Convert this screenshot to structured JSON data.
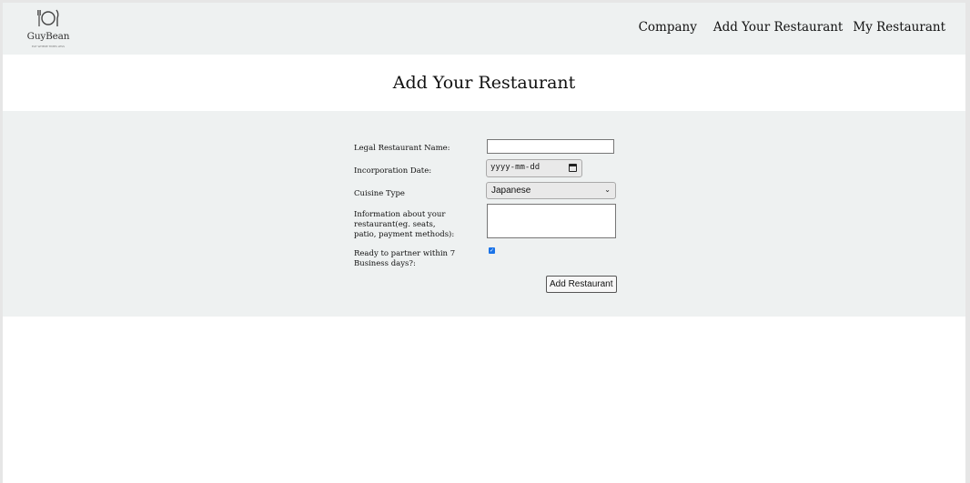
{
  "brand": {
    "name": "GuyBean",
    "tagline": "EAT WHERE TIMES LESS"
  },
  "nav": {
    "items": [
      "Company",
      "Add Your Restaurant",
      "My Restaurant"
    ]
  },
  "page": {
    "title": "Add Your Restaurant"
  },
  "form": {
    "legal_name_label": "Legal Restaurant Name:",
    "legal_name_value": "",
    "incorporation_date_label": "Incorporation Date:",
    "incorporation_date_placeholder": "yyyy-mm-dd",
    "cuisine_label": "Cuisine Type",
    "cuisine_selected": "Japanese",
    "info_label": "Information about your restaurant(eg. seats, patio, payment methods):",
    "info_value": "",
    "ready_label": "Ready to partner within 7 Business days?:",
    "ready_checked": true,
    "submit_label": "Add Restaurant"
  }
}
